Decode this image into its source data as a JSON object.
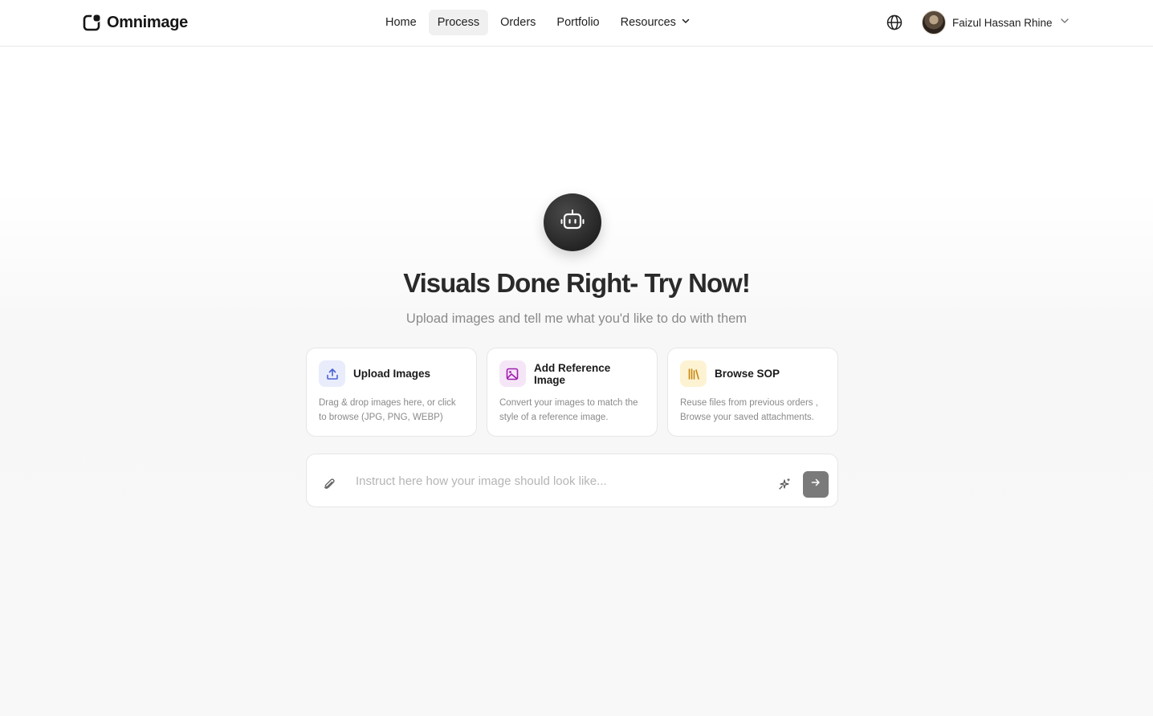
{
  "header": {
    "brand": "Omnimage",
    "nav": [
      {
        "label": "Home"
      },
      {
        "label": "Process"
      },
      {
        "label": "Orders"
      },
      {
        "label": "Portfolio"
      },
      {
        "label": "Resources"
      }
    ],
    "active_nav": "Process",
    "user_name": "Faizul Hassan Rhine"
  },
  "hero": {
    "title": "Visuals Done Right- Try Now!",
    "subtitle": "Upload images and tell me what you'd like to do with them"
  },
  "cards": [
    {
      "title": "Upload Images",
      "desc_line1": "Drag & drop images here, or click",
      "desc_line2": "to browse (JPG, PNG, WEBP)",
      "icon": "upload-icon",
      "accent": "#4a63d6",
      "bg": "#e9ecfb"
    },
    {
      "title": "Add Reference Image",
      "desc_line1": "Convert your images to match the",
      "desc_line2": "style of a reference image.",
      "icon": "image-icon",
      "accent": "#a21caf",
      "bg": "#f5e6f7"
    },
    {
      "title": "Browse SOP",
      "desc_line1": "Reuse files from previous orders ,",
      "desc_line2": "Browse your saved attachments.",
      "icon": "library-icon",
      "accent": "#c9860e",
      "bg": "#fdf3d3"
    }
  ],
  "prompt": {
    "placeholder": "Instruct here how your image should look like..."
  }
}
